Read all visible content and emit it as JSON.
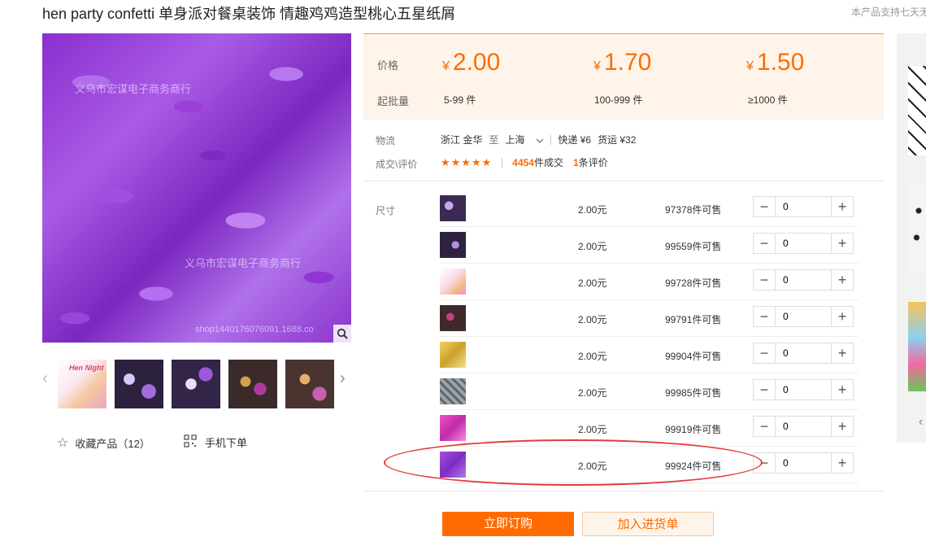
{
  "header": {
    "title": "hen party confetti 单身派对餐桌装饰 情趣鸡鸡造型桃心五星纸屑",
    "support_note": "本产品支持七天无"
  },
  "gallery": {
    "watermark_1": "义乌市宏谋电子商务商行",
    "watermark_2": "义乌市宏谋电子商务商行",
    "watermark_3": "shop1440176076091.1688.co",
    "thumb_0_text": "Hen Night"
  },
  "actions": {
    "favorite_label": "收藏产品（12）",
    "mobile_label": "手机下单"
  },
  "pricing": {
    "price_label": "价格",
    "moq_label": "起批量",
    "currency": "¥",
    "tiers": [
      {
        "price": "2.00",
        "moq": "5-99 件"
      },
      {
        "price": "1.70",
        "moq": "100-999 件"
      },
      {
        "price": "1.50",
        "moq": "≥1000 件"
      }
    ]
  },
  "logistics": {
    "label": "物流",
    "origin": "浙江 金华",
    "to": "至",
    "destination": "上海",
    "express": "快递 ¥6",
    "freight": "货运 ¥32"
  },
  "deal": {
    "label": "成交\\评价",
    "stars": "★★★★★",
    "count": "4454",
    "count_suffix": "件成交",
    "reviews": "1",
    "reviews_suffix": "条评价"
  },
  "size_label": "尺寸",
  "skus": [
    {
      "price": "2.00元",
      "stock": "97378件可售",
      "qty": "0"
    },
    {
      "price": "2.00元",
      "stock": "99559件可售",
      "qty": "0"
    },
    {
      "price": "2.00元",
      "stock": "99728件可售",
      "qty": "0"
    },
    {
      "price": "2.00元",
      "stock": "99791件可售",
      "qty": "0"
    },
    {
      "price": "2.00元",
      "stock": "99904件可售",
      "qty": "0"
    },
    {
      "price": "2.00元",
      "stock": "99985件可售",
      "qty": "0"
    },
    {
      "price": "2.00元",
      "stock": "99919件可售",
      "qty": "0"
    },
    {
      "price": "2.00元",
      "stock": "99924件可售",
      "qty": "0"
    }
  ],
  "buttons": {
    "order": "立即订购",
    "cart": "加入进货单"
  },
  "colors": {
    "accent": "#ff6b00",
    "price_bg": "#fff4ea",
    "annotation": "#e53a3a"
  }
}
